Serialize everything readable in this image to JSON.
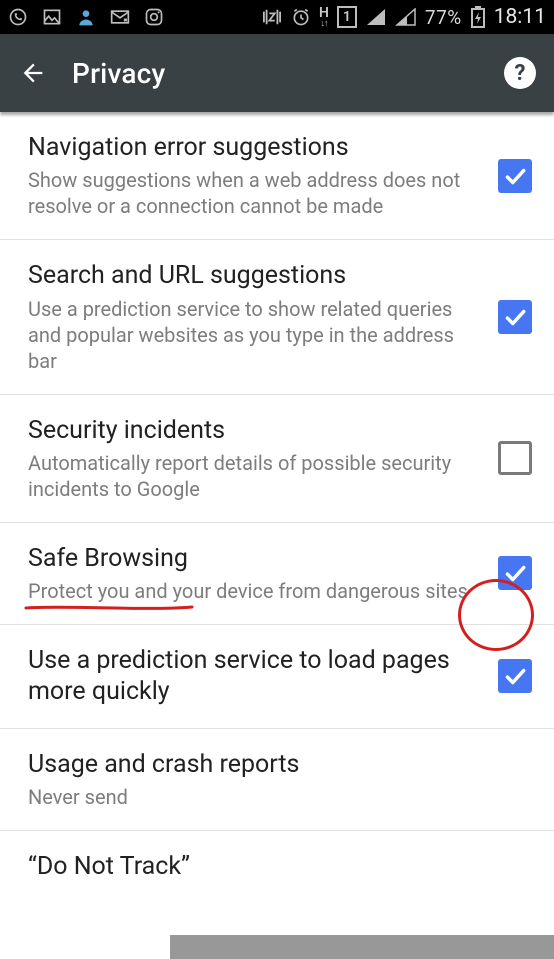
{
  "status": {
    "battery_pct": "77%",
    "clock": "18:11",
    "net_label": "H",
    "sim_badge": "1"
  },
  "appbar": {
    "title": "Privacy",
    "help_glyph": "?"
  },
  "items": [
    {
      "key": "nav-error",
      "title": "Navigation error suggestions",
      "sub": "Show suggestions when a web address does not resolve or a connection cannot be made",
      "checked": true,
      "has_checkbox": true
    },
    {
      "key": "search-url",
      "title": "Search and URL suggestions",
      "sub": "Use a prediction service to show related queries and popular websites as you type in the address bar",
      "checked": true,
      "has_checkbox": true
    },
    {
      "key": "security-incidents",
      "title": "Security incidents",
      "sub": "Automatically report details of possible security incidents to Google",
      "checked": false,
      "has_checkbox": true
    },
    {
      "key": "safe-browsing",
      "title": "Safe Browsing",
      "sub": "Protect you and your device from dangerous sites",
      "checked": true,
      "has_checkbox": true,
      "annotated": true
    },
    {
      "key": "prediction-load",
      "title": "Use a prediction service to load pages more quickly",
      "sub": "",
      "checked": true,
      "has_checkbox": true
    },
    {
      "key": "usage-crash",
      "title": "Usage and crash reports",
      "sub": "Never send",
      "has_checkbox": false
    },
    {
      "key": "do-not-track",
      "title": "“Do Not Track”",
      "sub": "",
      "has_checkbox": false,
      "truncated": true
    }
  ]
}
